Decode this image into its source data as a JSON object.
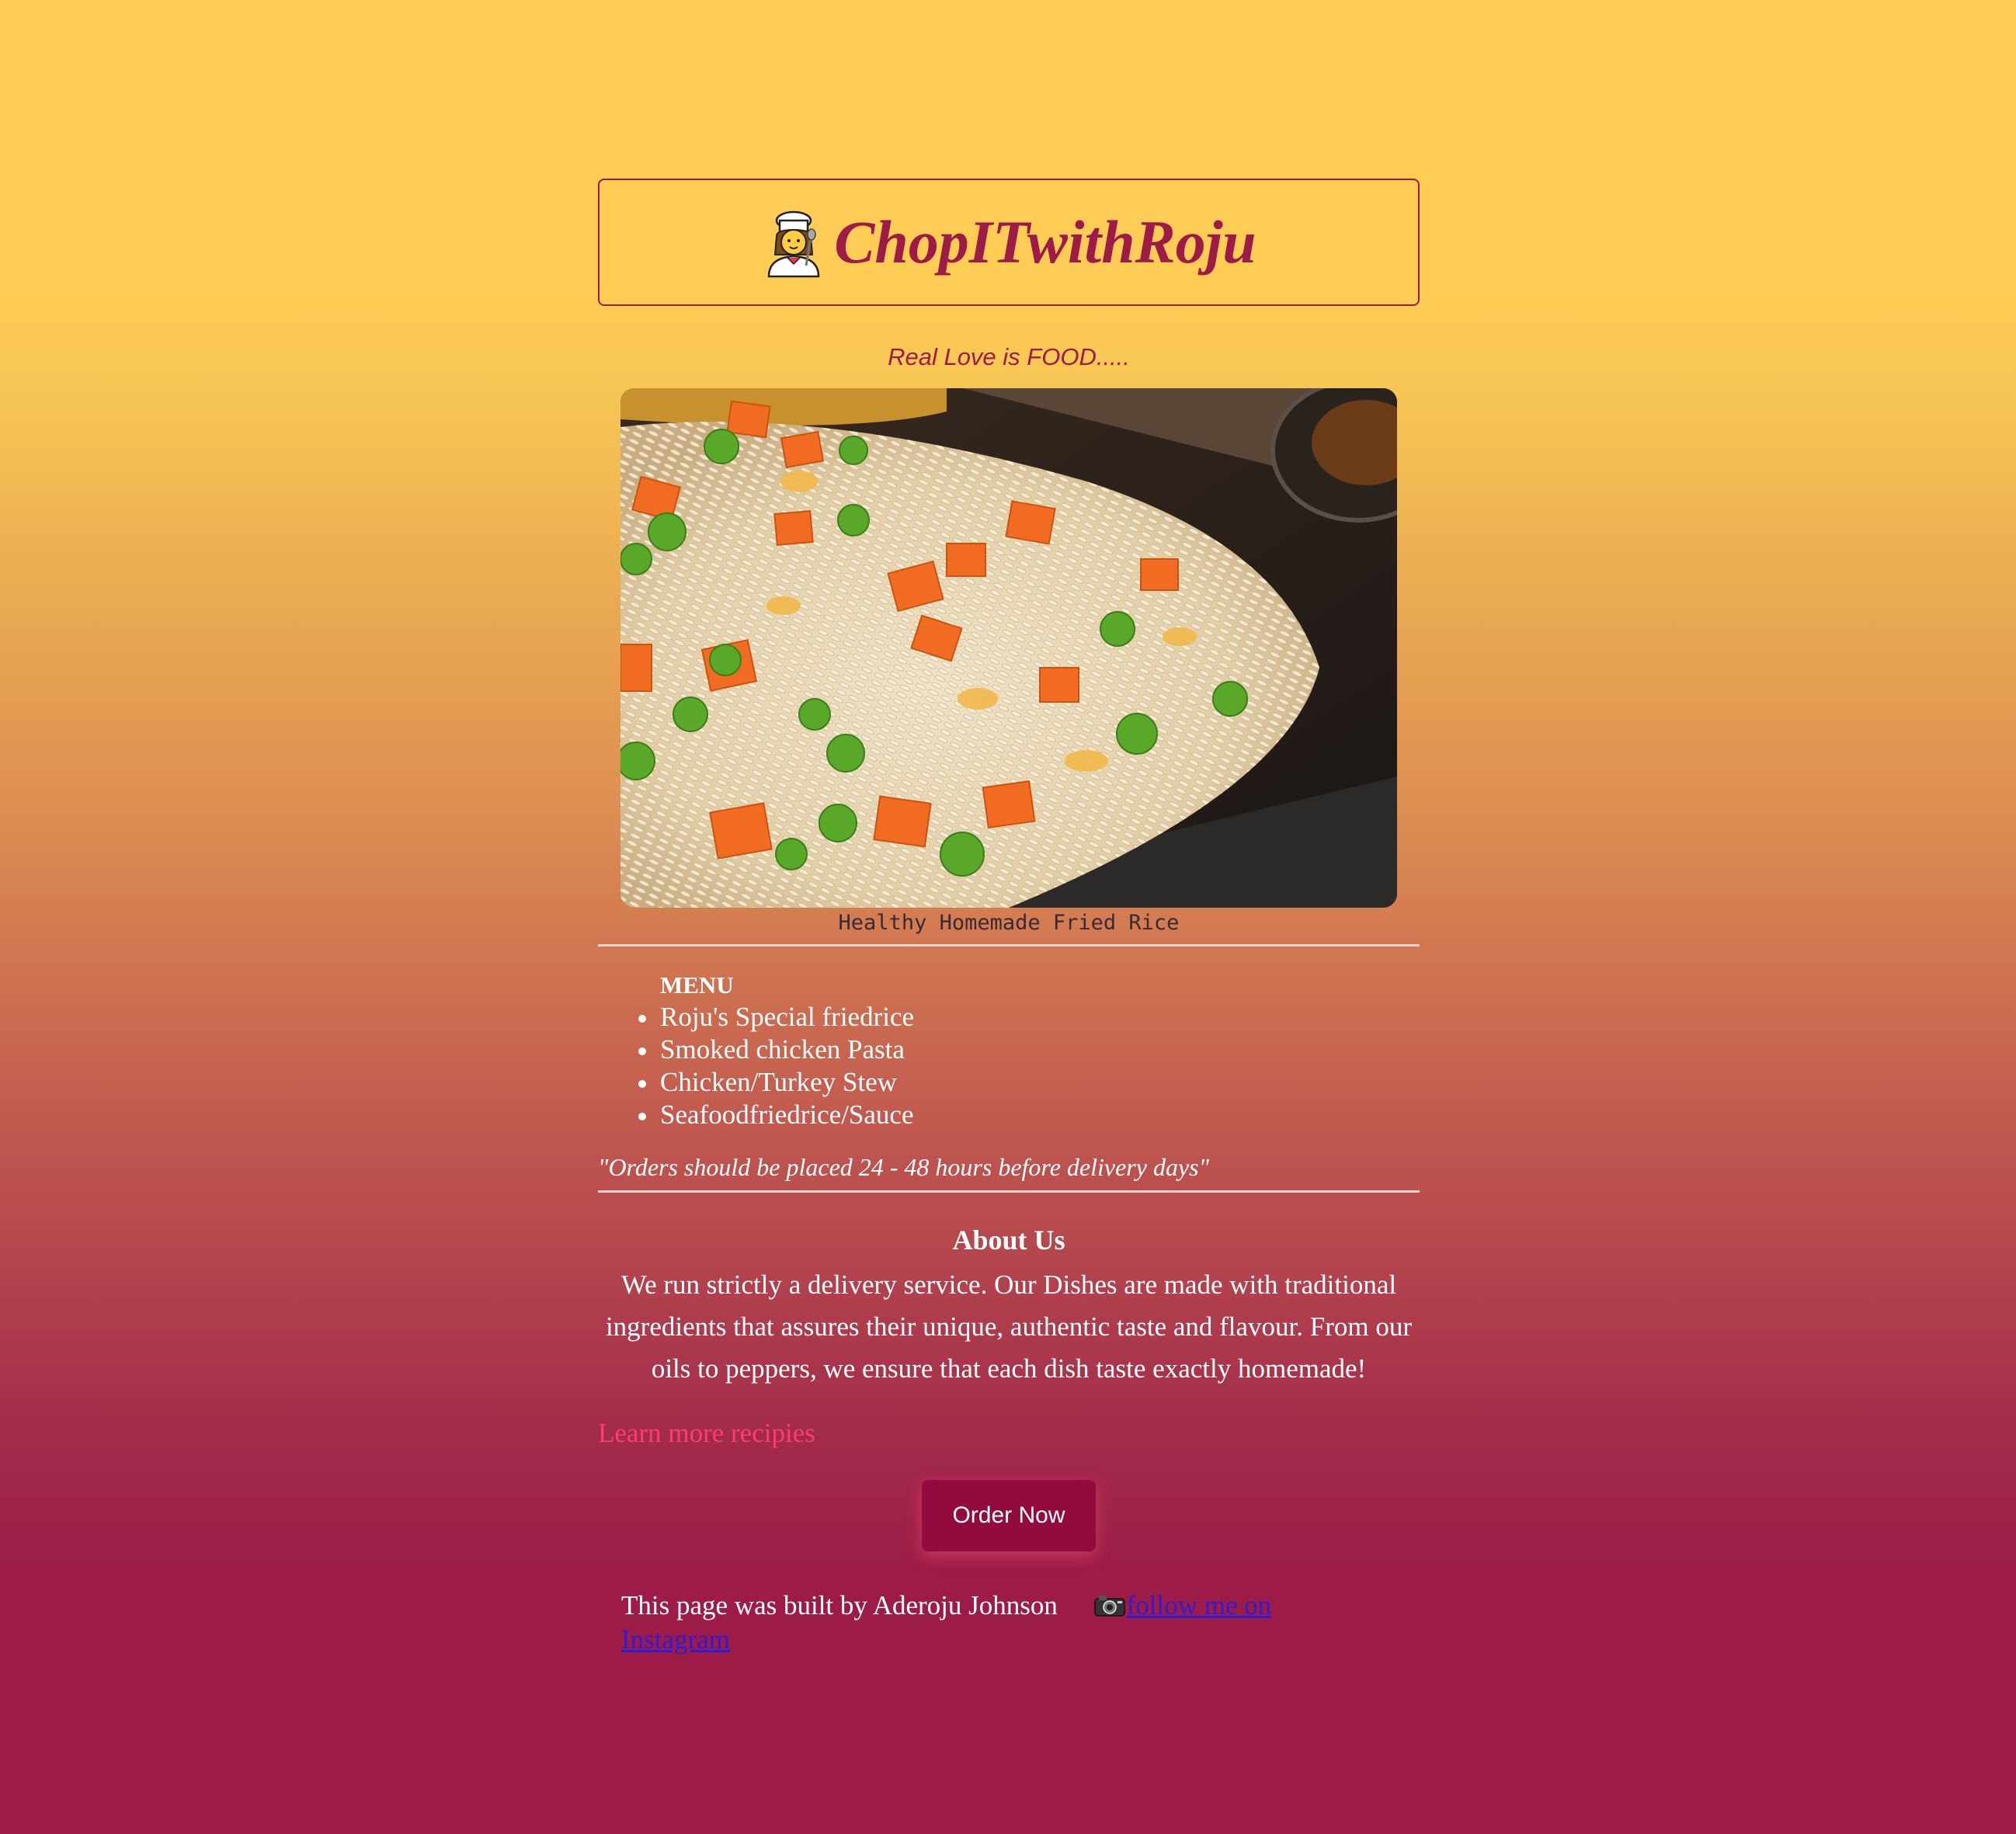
{
  "header": {
    "title": "ChopITwithRoju",
    "icon": "chef-icon"
  },
  "tagline": "Real Love is FOOD.....",
  "hero": {
    "image": "fried-rice-photo",
    "caption": "Healthy Homemade Fried Rice"
  },
  "menu": {
    "heading": "MENU",
    "items": [
      "Roju's Special friedrice",
      "Smoked chicken Pasta",
      "Chicken/Turkey Stew",
      "Seafoodfriedrice/Sauce"
    ]
  },
  "order_note": "\"Orders should be placed 24 - 48 hours before delivery days\"",
  "about": {
    "title": "About Us",
    "text": "We run strictly a delivery service. Our Dishes are made with traditional ingredients that assures their unique, authentic taste and flavour. From our oils to peppers, we ensure that each dish taste exactly homemade!"
  },
  "learn_more": "Learn more recipies",
  "order_button": "Order Now",
  "footer": {
    "credit": "This page was built by Aderoju Johnson",
    "instagram_link": "follow me on Instagram",
    "icon": "camera-icon"
  },
  "colors": {
    "brand": "#9c1b47",
    "button": "#930a3e",
    "link": "#ff3b6f",
    "gradient_top": "#ffcd55",
    "gradient_bottom": "#9c1b47"
  }
}
